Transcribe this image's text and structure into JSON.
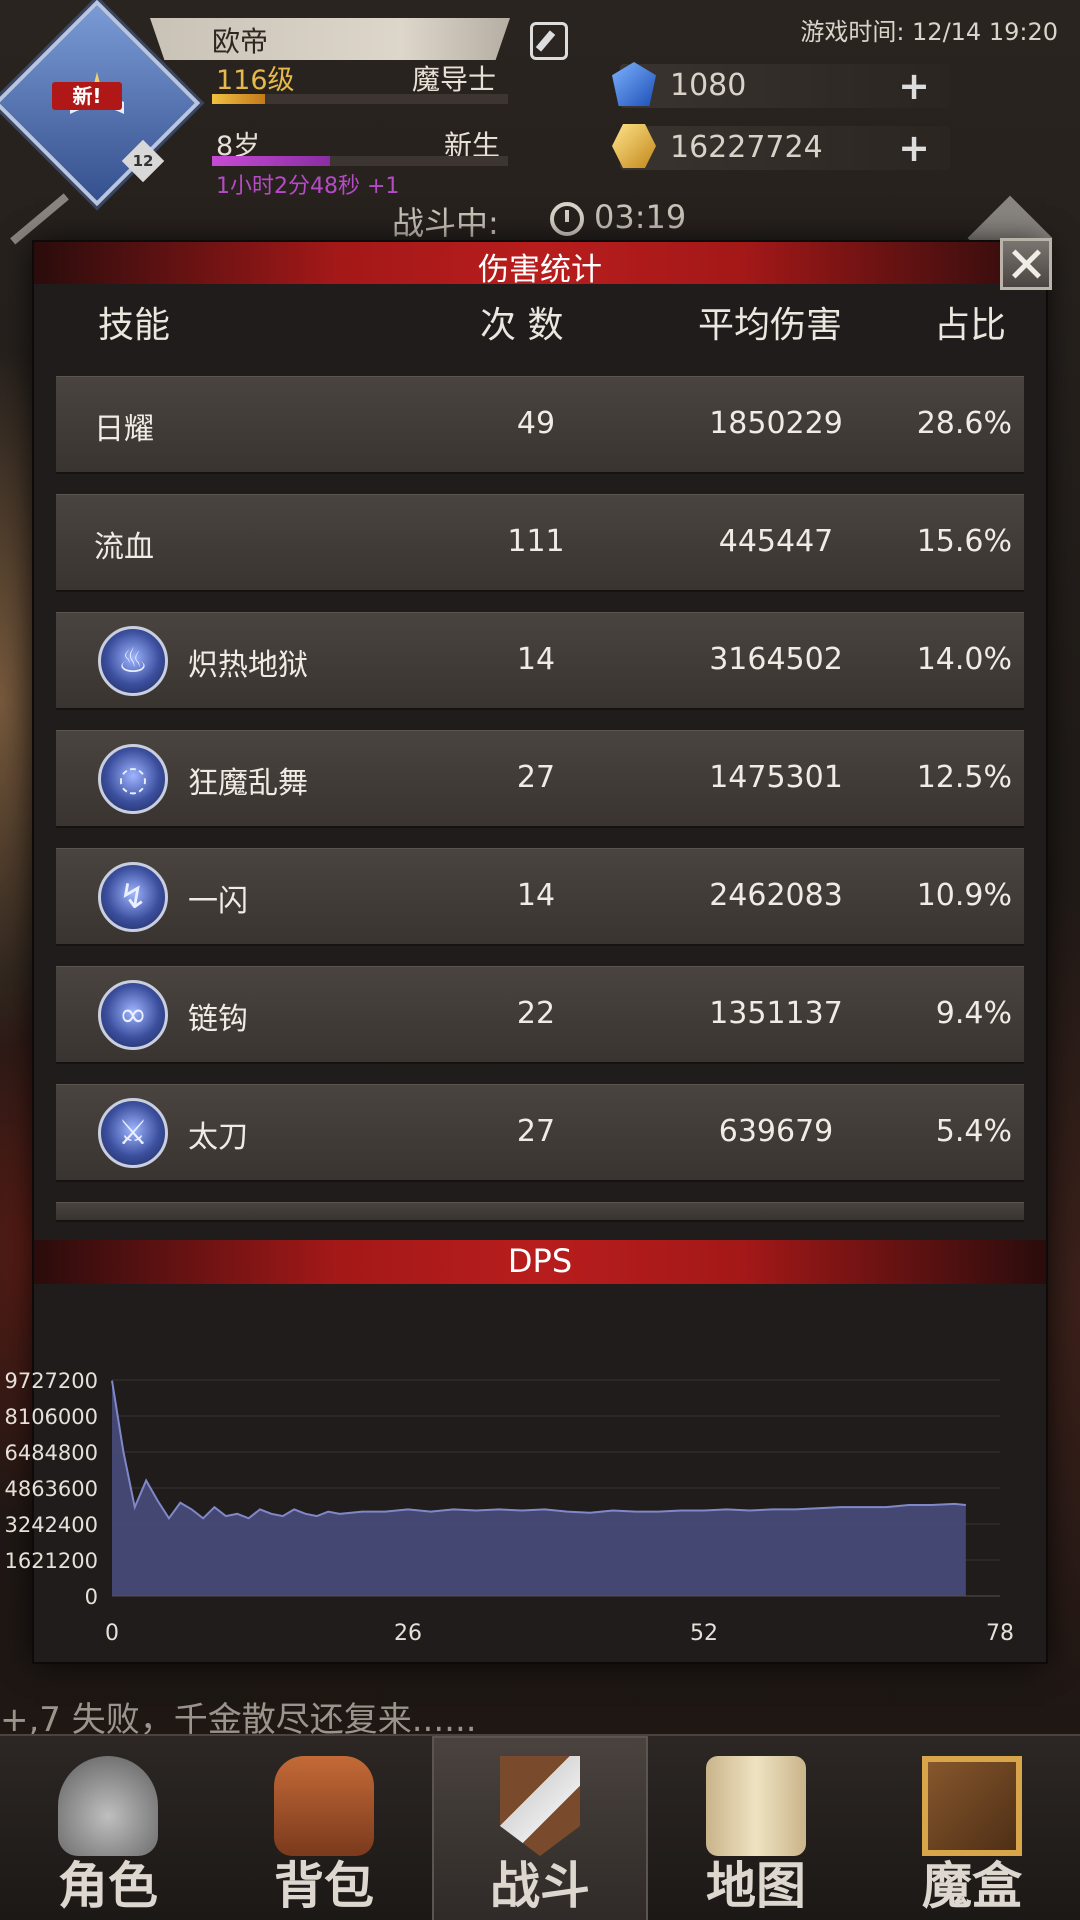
{
  "header": {
    "player_name": "欧帝",
    "emblem_badge": "新!",
    "emblem_level": "12",
    "level": "116级",
    "class": "魔导士",
    "age": "8岁",
    "stage": "新生",
    "timer_text": "1小时2分48秒 +1",
    "game_time": "游戏时间: 12/14 19:20",
    "level_progress": 0.18,
    "age_progress": 0.4
  },
  "currency": {
    "gems": "1080",
    "gold": "16227724",
    "gem_icon": "blue-gem-icon",
    "gold_icon": "gold-coin-icon"
  },
  "battle": {
    "status": "战斗中:",
    "time": "03:19"
  },
  "damage_panel": {
    "title": "伤害统计",
    "columns": {
      "skill": "技能",
      "count": "次 数",
      "avg": "平均伤害",
      "share": "占比"
    },
    "rows": [
      {
        "name": "日耀",
        "count": "49",
        "avg": "1850229",
        "share": "28.6%",
        "icon": ""
      },
      {
        "name": "流血",
        "count": "111",
        "avg": "445447",
        "share": "15.6%",
        "icon": ""
      },
      {
        "name": "炽热地狱",
        "count": "14",
        "avg": "3164502",
        "share": "14.0%",
        "icon": "flame-skill-icon"
      },
      {
        "name": "狂魔乱舞",
        "count": "27",
        "avg": "1475301",
        "share": "12.5%",
        "icon": "swirl-skill-icon"
      },
      {
        "name": "一闪",
        "count": "14",
        "avg": "2462083",
        "share": "10.9%",
        "icon": "lightning-skill-icon"
      },
      {
        "name": "链钩",
        "count": "22",
        "avg": "1351137",
        "share": "9.4%",
        "icon": "chain-skill-icon"
      },
      {
        "name": "太刀",
        "count": "27",
        "avg": "639679",
        "share": "5.4%",
        "icon": "sword-skill-icon"
      }
    ]
  },
  "dps_panel": {
    "title": "DPS"
  },
  "chart_data": {
    "type": "area",
    "title": "DPS",
    "xlabel": "",
    "ylabel": "",
    "x_ticks": [
      0,
      26,
      52,
      78
    ],
    "y_ticks": [
      0,
      1621200,
      3242400,
      4863600,
      6484800,
      8106000,
      9727200
    ],
    "xlim": [
      0,
      78
    ],
    "ylim": [
      0,
      9727200
    ],
    "grid": true,
    "fill_color": "#4a4f80",
    "line_color": "#8088c8",
    "x": [
      0,
      1,
      2,
      3,
      4,
      5,
      6,
      7,
      8,
      9,
      10,
      11,
      12,
      13,
      14,
      15,
      16,
      17,
      18,
      19,
      20,
      22,
      24,
      26,
      28,
      30,
      32,
      34,
      36,
      38,
      40,
      42,
      44,
      46,
      48,
      50,
      52,
      54,
      56,
      58,
      60,
      62,
      64,
      66,
      68,
      70,
      72,
      74,
      75
    ],
    "y": [
      9700000,
      6500000,
      4000000,
      5200000,
      4300000,
      3500000,
      4200000,
      3900000,
      3500000,
      4000000,
      3600000,
      3700000,
      3500000,
      3900000,
      3700000,
      3600000,
      3900000,
      3700000,
      3600000,
      3800000,
      3700000,
      3800000,
      3800000,
      3900000,
      3800000,
      3900000,
      3850000,
      3900000,
      3850000,
      3900000,
      3800000,
      3750000,
      3850000,
      3800000,
      3800000,
      3850000,
      3850000,
      3900000,
      3850000,
      3900000,
      3900000,
      3950000,
      4000000,
      4000000,
      4000000,
      4100000,
      4100000,
      4150000,
      4100000
    ]
  },
  "ticker": "+,7 失败，千金散尽还复来......",
  "tabs": [
    {
      "label": "角色",
      "icon": "helmet-icon"
    },
    {
      "label": "背包",
      "icon": "backpack-icon"
    },
    {
      "label": "战斗",
      "icon": "sword-shield-icon"
    },
    {
      "label": "地图",
      "icon": "scroll-map-icon"
    },
    {
      "label": "魔盒",
      "icon": "magic-box-icon"
    }
  ]
}
